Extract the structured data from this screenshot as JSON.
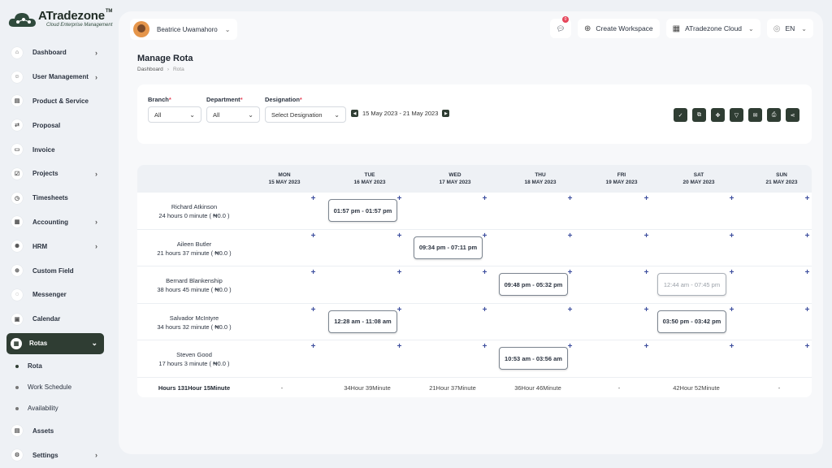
{
  "brand": {
    "name": "ATradezone",
    "tm": "TM",
    "tagline": "Cloud Enterprise Management"
  },
  "sidebar": {
    "items": [
      {
        "label": "Dashboard",
        "icon": "home-icon",
        "glyph": "⌂",
        "chevron": true
      },
      {
        "label": "User Management",
        "icon": "users-icon",
        "glyph": "☺",
        "chevron": true
      },
      {
        "label": "Product & Service",
        "icon": "cart-icon",
        "glyph": "▤",
        "chevron": false
      },
      {
        "label": "Proposal",
        "icon": "proposal-icon",
        "glyph": "⇄",
        "chevron": false
      },
      {
        "label": "Invoice",
        "icon": "invoice-icon",
        "glyph": "▭",
        "chevron": false
      },
      {
        "label": "Projects",
        "icon": "projects-icon",
        "glyph": "☑",
        "chevron": true
      },
      {
        "label": "Timesheets",
        "icon": "clock-icon",
        "glyph": "◷",
        "chevron": false
      },
      {
        "label": "Accounting",
        "icon": "accounting-icon",
        "glyph": "▦",
        "chevron": true
      },
      {
        "label": "HRM",
        "icon": "hrm-icon",
        "glyph": "✺",
        "chevron": true
      },
      {
        "label": "Custom Field",
        "icon": "custom-field-icon",
        "glyph": "⊕",
        "chevron": false
      },
      {
        "label": "Messenger",
        "icon": "chat-icon",
        "glyph": "◌",
        "chevron": false
      },
      {
        "label": "Calendar",
        "icon": "calendar-icon",
        "glyph": "▣",
        "chevron": false
      }
    ],
    "active": {
      "label": "Rotas",
      "icon": "rotas-icon",
      "glyph": "▦"
    },
    "submenu": [
      {
        "label": "Rota",
        "current": true
      },
      {
        "label": "Work Schedule",
        "current": false
      },
      {
        "label": "Availability",
        "current": false
      }
    ],
    "bottom": [
      {
        "label": "Assets",
        "icon": "assets-icon",
        "glyph": "▤",
        "chevron": false
      },
      {
        "label": "Settings",
        "icon": "gear-icon",
        "glyph": "⚙",
        "chevron": true
      }
    ]
  },
  "topbar": {
    "user_name": "Beatrice Uwamahoro",
    "message_count": "0",
    "create_workspace": "Create Workspace",
    "workspace": "ATradezone Cloud",
    "language": "EN"
  },
  "page": {
    "title": "Manage Rota",
    "breadcrumb": [
      "Dashboard",
      "Rota"
    ]
  },
  "filters": {
    "branch": {
      "label": "Branch",
      "value": "All"
    },
    "department": {
      "label": "Department",
      "value": "All"
    },
    "designation": {
      "label": "Designation",
      "value": "Select Designation"
    },
    "week_range": "15 May 2023 - 21 May 2023",
    "actions": [
      {
        "name": "publish-week-button",
        "icon": "check-icon",
        "glyph": "✓"
      },
      {
        "name": "copy-week-button",
        "icon": "copy-icon",
        "glyph": "⧉"
      },
      {
        "name": "move-button",
        "icon": "move-icon",
        "glyph": "✥"
      },
      {
        "name": "filter-button",
        "icon": "filter-icon",
        "glyph": "▽"
      },
      {
        "name": "email-button",
        "icon": "mail-icon",
        "glyph": "✉"
      },
      {
        "name": "print-button",
        "icon": "print-icon",
        "glyph": "⎙"
      },
      {
        "name": "share-button",
        "icon": "share-icon",
        "glyph": "⋖"
      }
    ]
  },
  "rota": {
    "days": [
      {
        "day": "MON",
        "date": "15 MAY 2023",
        "total": "-"
      },
      {
        "day": "TUE",
        "date": "16 MAY 2023",
        "total": "34Hour 39Minute"
      },
      {
        "day": "WED",
        "date": "17 MAY 2023",
        "total": "21Hour 37Minute"
      },
      {
        "day": "THU",
        "date": "18 MAY 2023",
        "total": "36Hour 46Minute"
      },
      {
        "day": "FRI",
        "date": "19 MAY 2023",
        "total": "-"
      },
      {
        "day": "SAT",
        "date": "20 MAY 2023",
        "total": "42Hour 52Minute"
      },
      {
        "day": "SUN",
        "date": "21 MAY 2023",
        "total": "-"
      }
    ],
    "employees": [
      {
        "name": "Richard Atkinson",
        "hours": "24 hours 0 minute ( ₦0.0 )",
        "shifts": [
          {
            "day": 1,
            "time": "01:57 pm - 01:57 pm",
            "faded": false
          }
        ]
      },
      {
        "name": "Aileen Butler",
        "hours": "21 hours 37 minute ( ₦0.0 )",
        "shifts": [
          {
            "day": 2,
            "time": "09:34 pm - 07:11 pm",
            "faded": false
          }
        ]
      },
      {
        "name": "Bernard Blankenship",
        "hours": "38 hours 45 minute ( ₦0.0 )",
        "shifts": [
          {
            "day": 3,
            "time": "09:48 pm - 05:32 pm",
            "faded": false
          },
          {
            "day": 5,
            "time": "12:44 am - 07:45 pm",
            "faded": true
          }
        ]
      },
      {
        "name": "Salvador McIntyre",
        "hours": "34 hours 32 minute ( ₦0.0 )",
        "shifts": [
          {
            "day": 1,
            "time": "12:28 am - 11:08 am",
            "faded": false
          },
          {
            "day": 5,
            "time": "03:50 pm - 03:42 pm",
            "faded": false
          }
        ]
      },
      {
        "name": "Steven Good",
        "hours": "17 hours 3 minute ( ₦0.0 )",
        "shifts": [
          {
            "day": 3,
            "time": "10:53 am - 03:56 am",
            "faded": false
          }
        ]
      }
    ],
    "total_label": "Hours 131Hour 15Minute",
    "add_glyph": "+"
  }
}
